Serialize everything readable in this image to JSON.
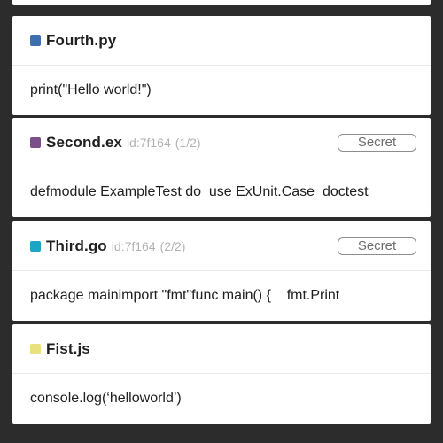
{
  "snippets": [
    {
      "file": "Fourth.py",
      "color": "#3d6fae",
      "id_text": "",
      "page_text": "",
      "secret_label": "",
      "code": "print(\"Hello world!\")"
    },
    {
      "file": "Second.ex",
      "color": "#7b4f88",
      "id_text": "id:7f164",
      "page_text": "(1/2)",
      "secret_label": "Secret",
      "code": "defmodule ExampleTest do  use ExUnit.Case  doctest"
    },
    {
      "file": "Third.go",
      "color": "#1aa6c4",
      "id_text": "id:7f164",
      "page_text": "(2/2)",
      "secret_label": "Secret",
      "code": "package mainimport \"fmt\"func main() {    fmt.Print"
    },
    {
      "file": "Fist.js",
      "color": "#eae07e",
      "id_text": "",
      "page_text": "",
      "secret_label": "",
      "code": "console.log(‘helloworld’)"
    }
  ]
}
